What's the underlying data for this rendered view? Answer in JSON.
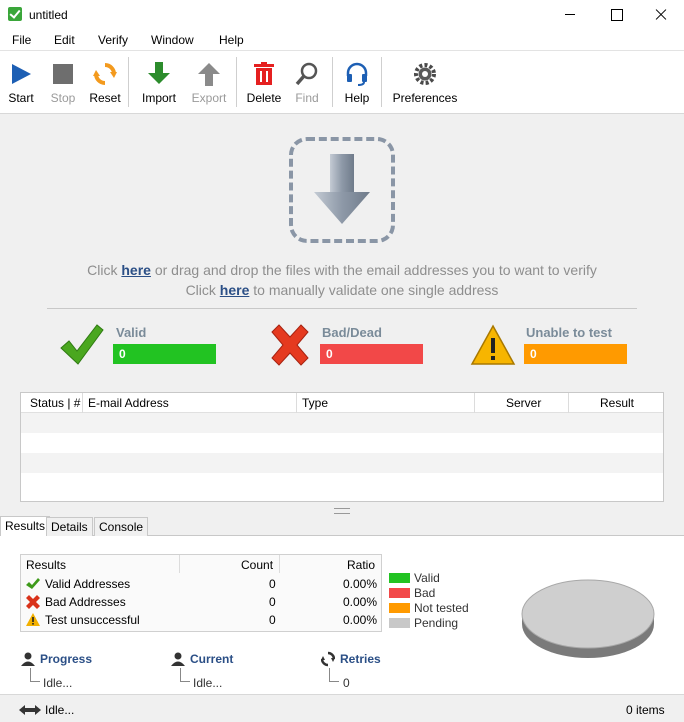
{
  "window": {
    "title": "untitled"
  },
  "menu": [
    "File",
    "Edit",
    "Verify",
    "Window",
    "Help"
  ],
  "toolbar": {
    "start": "Start",
    "stop": "Stop",
    "reset": "Reset",
    "import": "Import",
    "export": "Export",
    "delete": "Delete",
    "find": "Find",
    "help": "Help",
    "preferences": "Preferences"
  },
  "drop": {
    "line1_pre": "Click ",
    "line1_link": "here",
    "line1_post": " or drag and drop the files with the email addresses you to want to verify",
    "line2_pre": "Click ",
    "line2_link": "here",
    "line2_post": " to manually validate one single address"
  },
  "stats": {
    "valid": {
      "label": "Valid",
      "value": "0",
      "color": "#22c322"
    },
    "bad": {
      "label": "Bad/Dead",
      "value": "0",
      "color": "#f24848"
    },
    "unable": {
      "label": "Unable to test",
      "value": "0",
      "color": "#ff9a00"
    }
  },
  "grid": {
    "columns": [
      "Status | #",
      "E-mail Address",
      "Type",
      "Server",
      "Result"
    ]
  },
  "tabs": [
    "Results",
    "Details",
    "Console"
  ],
  "results": {
    "headers": [
      "Results",
      "Count",
      "Ratio"
    ],
    "rows": [
      {
        "label": "Valid Addresses",
        "count": "0",
        "ratio": "0.00%",
        "icon": "check-icon"
      },
      {
        "label": "Bad Addresses",
        "count": "0",
        "ratio": "0.00%",
        "icon": "x-icon"
      },
      {
        "label": "Test unsuccessful",
        "count": "0",
        "ratio": "0.00%",
        "icon": "warning-icon"
      }
    ],
    "legend": [
      {
        "label": "Valid",
        "color": "#22c322"
      },
      {
        "label": "Bad",
        "color": "#f24848"
      },
      {
        "label": "Not tested",
        "color": "#ff9a00"
      },
      {
        "label": "Pending",
        "color": "#c8c8c8"
      }
    ]
  },
  "progress": {
    "label": "Progress",
    "value": "Idle..."
  },
  "current": {
    "label": "Current",
    "value": "Idle..."
  },
  "retries": {
    "label": "Retries",
    "value": "0"
  },
  "status": {
    "text": "Idle...",
    "items": "0 items"
  }
}
